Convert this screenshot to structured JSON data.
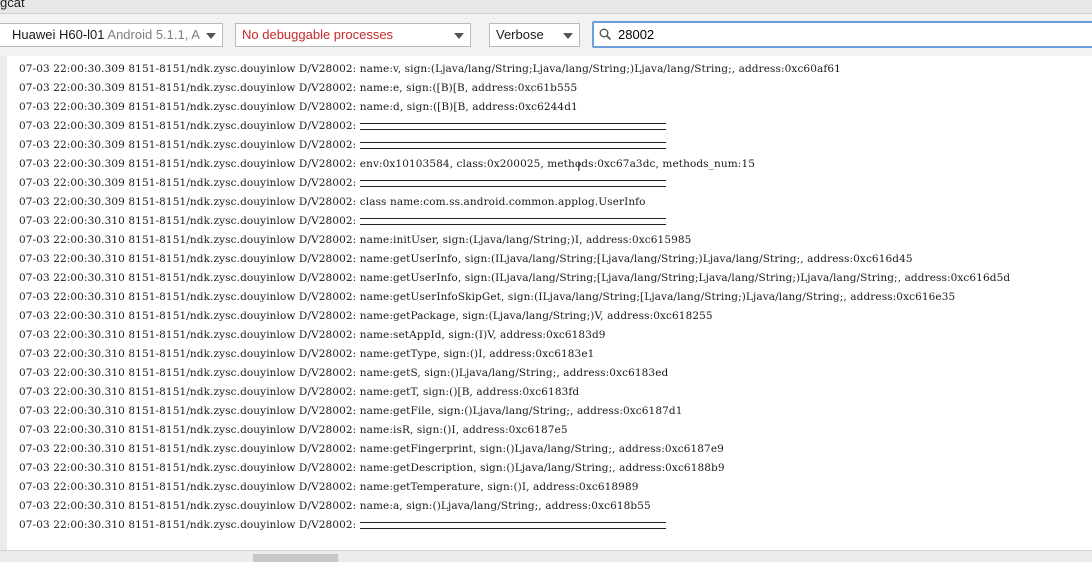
{
  "panel": {
    "title": "gcat"
  },
  "toolbar": {
    "device": {
      "name": "Huawei H60-l01",
      "detail": "Android 5.1.1, A"
    },
    "process_select": {
      "value": "No debuggable processes"
    },
    "log_level": {
      "value": "Verbose"
    },
    "search": {
      "value": "28002",
      "icon": "search-icon"
    }
  },
  "colors": {
    "process_warning": "#c62828",
    "search_focus_border": "#6a9fd8"
  },
  "log_lines": [
    {
      "prefix": "07-03 22:00:30.309 8151-8151/ndk.zysc.douyinlow D/V28002:",
      "message": "name:v, sign:(Ljava/lang/String;Ljava/lang/String;)Ljava/lang/String;, address:0xc60af61",
      "separator": false
    },
    {
      "prefix": "07-03 22:00:30.309 8151-8151/ndk.zysc.douyinlow D/V28002:",
      "message": "name:e, sign:([B)[B, address:0xc61b555",
      "separator": false
    },
    {
      "prefix": "07-03 22:00:30.309 8151-8151/ndk.zysc.douyinlow D/V28002:",
      "message": "name:d, sign:([B)[B, address:0xc6244d1",
      "separator": false
    },
    {
      "prefix": "07-03 22:00:30.309 8151-8151/ndk.zysc.douyinlow D/V28002:",
      "message": "",
      "separator": true
    },
    {
      "prefix": "07-03 22:00:30.309 8151-8151/ndk.zysc.douyinlow D/V28002:",
      "message": "",
      "separator": true
    },
    {
      "prefix": "07-03 22:00:30.309 8151-8151/ndk.zysc.douyinlow D/V28002:",
      "message": "env:0x10103584, class:0x200025, methods:0xc67a3dc, methods_num:15",
      "separator": false
    },
    {
      "prefix": "07-03 22:00:30.309 8151-8151/ndk.zysc.douyinlow D/V28002:",
      "message": "",
      "separator": true
    },
    {
      "prefix": "07-03 22:00:30.309 8151-8151/ndk.zysc.douyinlow D/V28002:",
      "message": "class name:com.ss.android.common.applog.UserInfo",
      "separator": false
    },
    {
      "prefix": "07-03 22:00:30.310 8151-8151/ndk.zysc.douyinlow D/V28002:",
      "message": "",
      "separator": true
    },
    {
      "prefix": "07-03 22:00:30.310 8151-8151/ndk.zysc.douyinlow D/V28002:",
      "message": "name:initUser, sign:(Ljava/lang/String;)I, address:0xc615985",
      "separator": false
    },
    {
      "prefix": "07-03 22:00:30.310 8151-8151/ndk.zysc.douyinlow D/V28002:",
      "message": "name:getUserInfo, sign:(ILjava/lang/String;[Ljava/lang/String;)Ljava/lang/String;, address:0xc616d45",
      "separator": false
    },
    {
      "prefix": "07-03 22:00:30.310 8151-8151/ndk.zysc.douyinlow D/V28002:",
      "message": "name:getUserInfo, sign:(ILjava/lang/String;[Ljava/lang/String;Ljava/lang/String;)Ljava/lang/String;, address:0xc616d5d",
      "separator": false
    },
    {
      "prefix": "07-03 22:00:30.310 8151-8151/ndk.zysc.douyinlow D/V28002:",
      "message": "name:getUserInfoSkipGet, sign:(ILjava/lang/String;[Ljava/lang/String;)Ljava/lang/String;, address:0xc616e35",
      "separator": false
    },
    {
      "prefix": "07-03 22:00:30.310 8151-8151/ndk.zysc.douyinlow D/V28002:",
      "message": "name:getPackage, sign:(Ljava/lang/String;)V, address:0xc618255",
      "separator": false
    },
    {
      "prefix": "07-03 22:00:30.310 8151-8151/ndk.zysc.douyinlow D/V28002:",
      "message": "name:setAppId, sign:(I)V, address:0xc6183d9",
      "separator": false
    },
    {
      "prefix": "07-03 22:00:30.310 8151-8151/ndk.zysc.douyinlow D/V28002:",
      "message": "name:getType, sign:()I, address:0xc6183e1",
      "separator": false
    },
    {
      "prefix": "07-03 22:00:30.310 8151-8151/ndk.zysc.douyinlow D/V28002:",
      "message": "name:getS, sign:()Ljava/lang/String;, address:0xc6183ed",
      "separator": false
    },
    {
      "prefix": "07-03 22:00:30.310 8151-8151/ndk.zysc.douyinlow D/V28002:",
      "message": "name:getT, sign:()[B, address:0xc6183fd",
      "separator": false
    },
    {
      "prefix": "07-03 22:00:30.310 8151-8151/ndk.zysc.douyinlow D/V28002:",
      "message": "name:getFile, sign:()Ljava/lang/String;, address:0xc6187d1",
      "separator": false
    },
    {
      "prefix": "07-03 22:00:30.310 8151-8151/ndk.zysc.douyinlow D/V28002:",
      "message": "name:isR, sign:()I, address:0xc6187e5",
      "separator": false
    },
    {
      "prefix": "07-03 22:00:30.310 8151-8151/ndk.zysc.douyinlow D/V28002:",
      "message": "name:getFingerprint, sign:()Ljava/lang/String;, address:0xc6187e9",
      "separator": false
    },
    {
      "prefix": "07-03 22:00:30.310 8151-8151/ndk.zysc.douyinlow D/V28002:",
      "message": "name:getDescription, sign:()Ljava/lang/String;, address:0xc6188b9",
      "separator": false
    },
    {
      "prefix": "07-03 22:00:30.310 8151-8151/ndk.zysc.douyinlow D/V28002:",
      "message": "name:getTemperature, sign:()I, address:0xc618989",
      "separator": false
    },
    {
      "prefix": "07-03 22:00:30.310 8151-8151/ndk.zysc.douyinlow D/V28002:",
      "message": "name:a, sign:()Ljava/lang/String;, address:0xc618b55",
      "separator": false
    },
    {
      "prefix": "07-03 22:00:30.310 8151-8151/ndk.zysc.douyinlow D/V28002:",
      "message": "",
      "separator": true
    }
  ]
}
